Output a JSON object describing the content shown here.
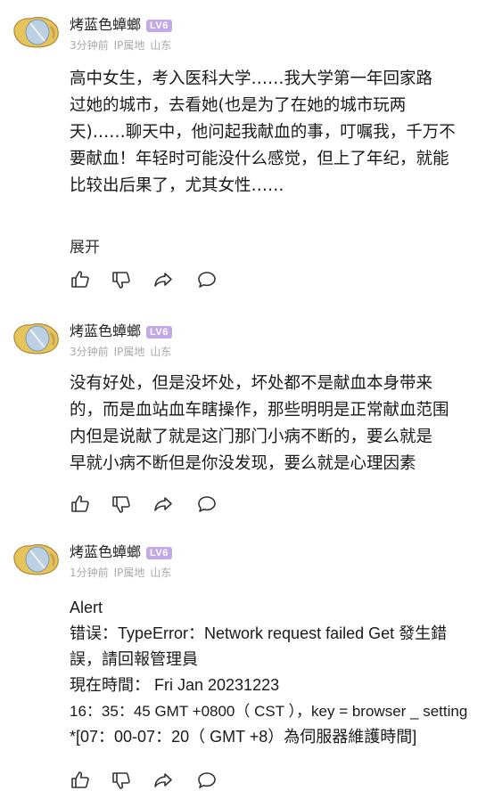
{
  "comments": [
    {
      "username": "烤蓝色蟑螂",
      "level": "LV6",
      "time": "3分钟前",
      "ip": "IP属地",
      "location": "山东",
      "body_lines": [
        "高中女生，考入医科大学……我大学第一年回家路",
        "过她的城市，去看她(也是为了在她的城市玩两",
        "天)……聊天中，他问起我献血的事，叮嘱我，千万不",
        "要献血！年轻时可能没什么感觉，但上了年纪，就能",
        "比较出后果了，尤其女性……"
      ],
      "expand_label": "展开"
    },
    {
      "username": "烤蓝色蟑螂",
      "level": "LV6",
      "time": "3分钟前",
      "ip": "IP属地",
      "location": "山东",
      "body_lines": [
        "没有好处，但是没坏处，坏处都不是献血本身带来",
        "的，而是血站血车瞎操作，那些明明是正常献血范围",
        "内但是说献了就是这门那门小病不断的，要么就是",
        "早就小病不断但是你没发现，要么就是心理因素"
      ]
    },
    {
      "username": "烤蓝色蟑螂",
      "level": "LV6",
      "time": "1分钟前",
      "ip": "IP属地",
      "location": "山东",
      "alert_lines": [
        "Alert",
        "错误：TypeError：Network request failed Get 發生錯",
        "誤，請回報管理員",
        "現在時間： Fri Jan 20231223",
        "16：35：45 GMT +0800（ CST ），key = browser _ setting",
        "*[07：00-07：20（ GMT +8）為伺服器維護時間]"
      ]
    }
  ],
  "icons": {
    "like": "thumbs-up-icon",
    "dislike": "thumbs-down-icon",
    "share": "share-icon",
    "reply": "comment-icon"
  },
  "colors": {
    "badge": "#c0a9e6",
    "meta": "#a9a9a9",
    "icon": "#333333"
  }
}
